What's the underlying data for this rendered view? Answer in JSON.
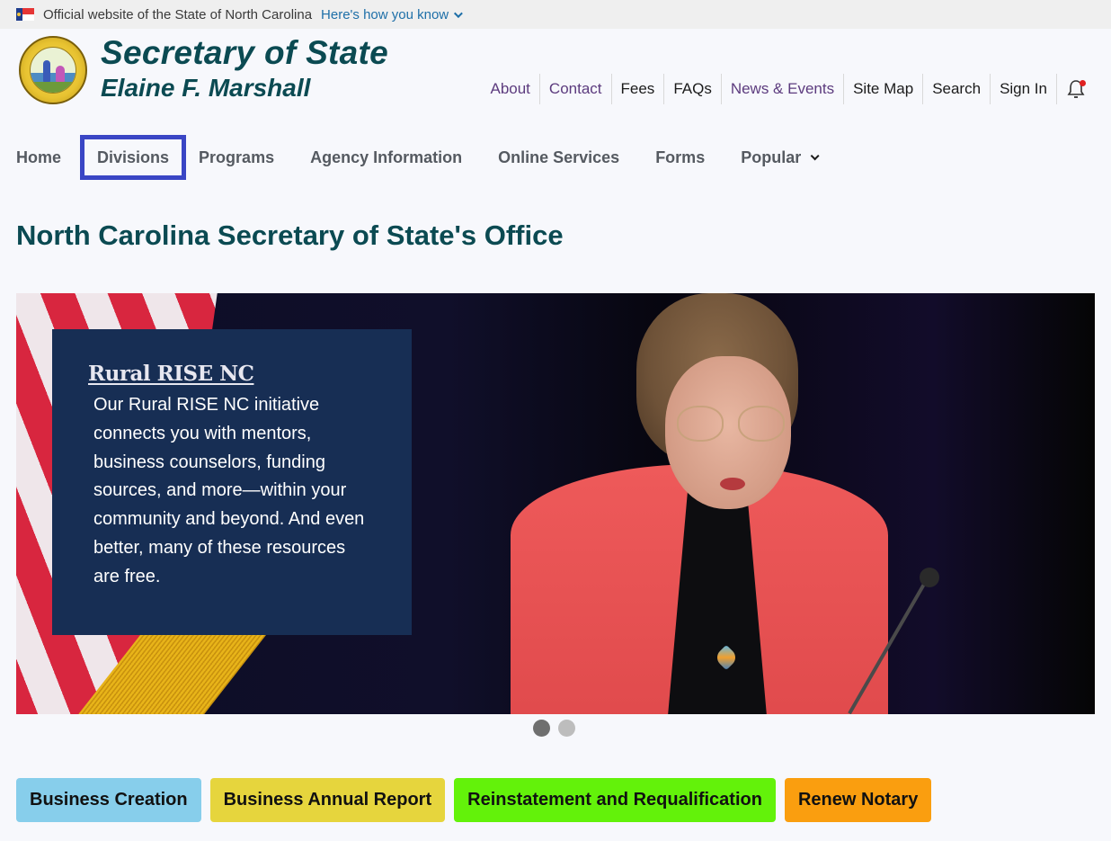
{
  "gov_banner": {
    "text": "Official website of the State of North Carolina",
    "link_label": "Here's how you know"
  },
  "header": {
    "title": "Secretary of State",
    "subtitle": "Elaine F. Marshall"
  },
  "utility_nav": [
    {
      "label": "About",
      "color": "#5c3b7e"
    },
    {
      "label": "Contact",
      "color": "#5c3b7e"
    },
    {
      "label": "Fees",
      "color": "#1b1b1b"
    },
    {
      "label": "FAQs",
      "color": "#1b1b1b"
    },
    {
      "label": "News & Events",
      "color": "#5c3b7e"
    },
    {
      "label": "Site Map",
      "color": "#1b1b1b"
    },
    {
      "label": "Search",
      "color": "#1b1b1b"
    },
    {
      "label": "Sign In",
      "color": "#1b1b1b"
    }
  ],
  "notifications": {
    "icon": "bell-icon",
    "has_unread": true
  },
  "main_nav": {
    "items": [
      {
        "label": "Home"
      },
      {
        "label": "Divisions",
        "active": true
      },
      {
        "label": "Programs"
      },
      {
        "label": "Agency Information"
      },
      {
        "label": "Online Services"
      },
      {
        "label": "Forms"
      },
      {
        "label": "Popular",
        "has_dropdown": true
      }
    ]
  },
  "page": {
    "title": "North Carolina Secretary of State's Office"
  },
  "hero": {
    "card_title": "Rural RISE NC",
    "card_text": "Our Rural RISE NC initiative connects you with mentors, business counselors, funding sources, and more—within your community and beyond. And even better, many of these resources are free.",
    "image_alt": "Elaine F. Marshall speaking at a microphone",
    "slides_total": 2,
    "active_slide": 1
  },
  "quick_links": [
    {
      "label": "Business Creation",
      "color": "#87ceeb"
    },
    {
      "label": "Business Annual Report",
      "color": "#e6d53d"
    },
    {
      "label": "Reinstatement and Requalification",
      "color": "#63f20a"
    },
    {
      "label": "Renew Notary",
      "color": "#fa9e0f"
    }
  ],
  "colors": {
    "brand_teal": "#0b4a52",
    "nav_focus": "#3a46c5",
    "card_navy": "#172e54"
  }
}
